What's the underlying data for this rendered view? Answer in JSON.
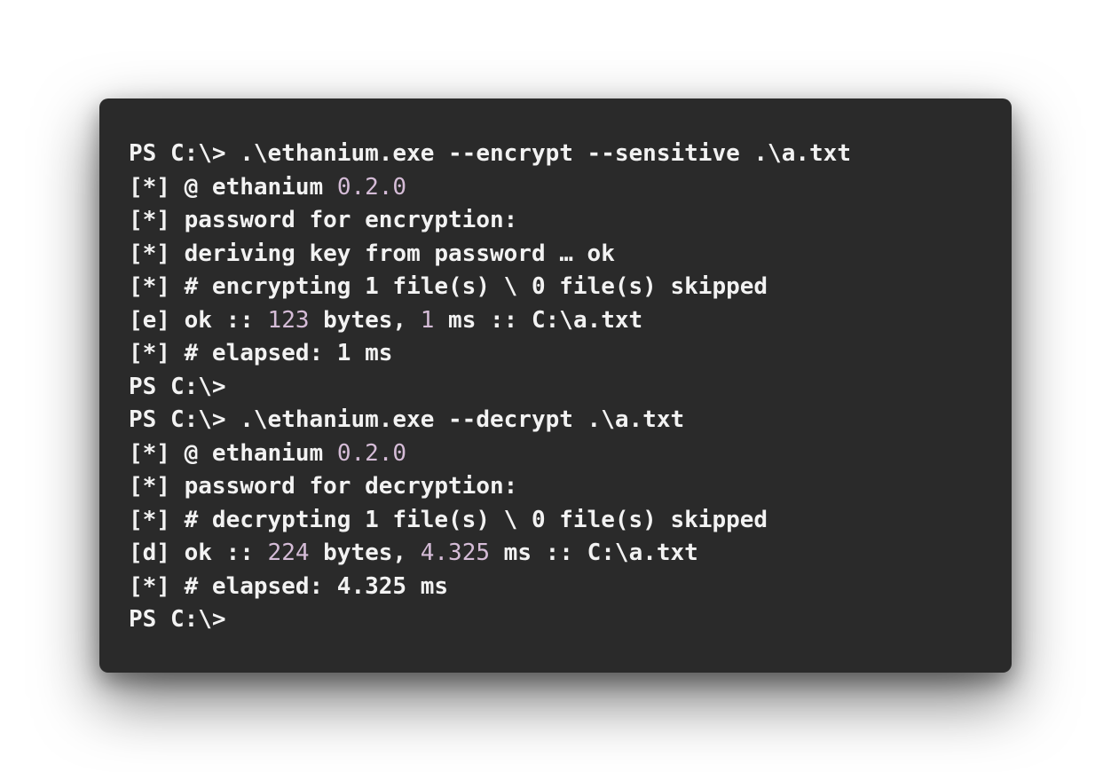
{
  "colors": {
    "terminal_background": "#2a2a2a",
    "text": "#f2f2f2",
    "number_highlight": "#d5bcd7",
    "page_background": "#ffffff"
  },
  "terminal": {
    "lines": [
      [
        {
          "t": "PS C:\\> .\\ethanium.exe --encrypt --sensitive .\\a.txt"
        }
      ],
      [
        {
          "t": "[*] @ ethanium "
        },
        {
          "t": "0.2.0",
          "hl": true
        }
      ],
      [
        {
          "t": "[*] password for encryption:"
        }
      ],
      [
        {
          "t": "[*] deriving key from password … ok"
        }
      ],
      [
        {
          "t": "[*] # encrypting 1 file(s) \\ 0 file(s) skipped"
        }
      ],
      [
        {
          "t": "[e] ok :: "
        },
        {
          "t": "123",
          "hl": true
        },
        {
          "t": " bytes, "
        },
        {
          "t": "1",
          "hl": true
        },
        {
          "t": " ms :: C:\\a.txt"
        }
      ],
      [
        {
          "t": "[*] # elapsed: 1 ms"
        }
      ],
      [
        {
          "t": "PS C:\\>"
        }
      ],
      [
        {
          "t": "PS C:\\> .\\ethanium.exe --decrypt .\\a.txt"
        }
      ],
      [
        {
          "t": "[*] @ ethanium "
        },
        {
          "t": "0.2.0",
          "hl": true
        }
      ],
      [
        {
          "t": "[*] password for decryption:"
        }
      ],
      [
        {
          "t": "[*] # decrypting 1 file(s) \\ 0 file(s) skipped"
        }
      ],
      [
        {
          "t": "[d] ok :: "
        },
        {
          "t": "224",
          "hl": true
        },
        {
          "t": " bytes, "
        },
        {
          "t": "4.325",
          "hl": true
        },
        {
          "t": " ms :: C:\\a.txt"
        }
      ],
      [
        {
          "t": "[*] # elapsed: 4.325 ms"
        }
      ],
      [
        {
          "t": "PS C:\\>"
        }
      ]
    ]
  }
}
